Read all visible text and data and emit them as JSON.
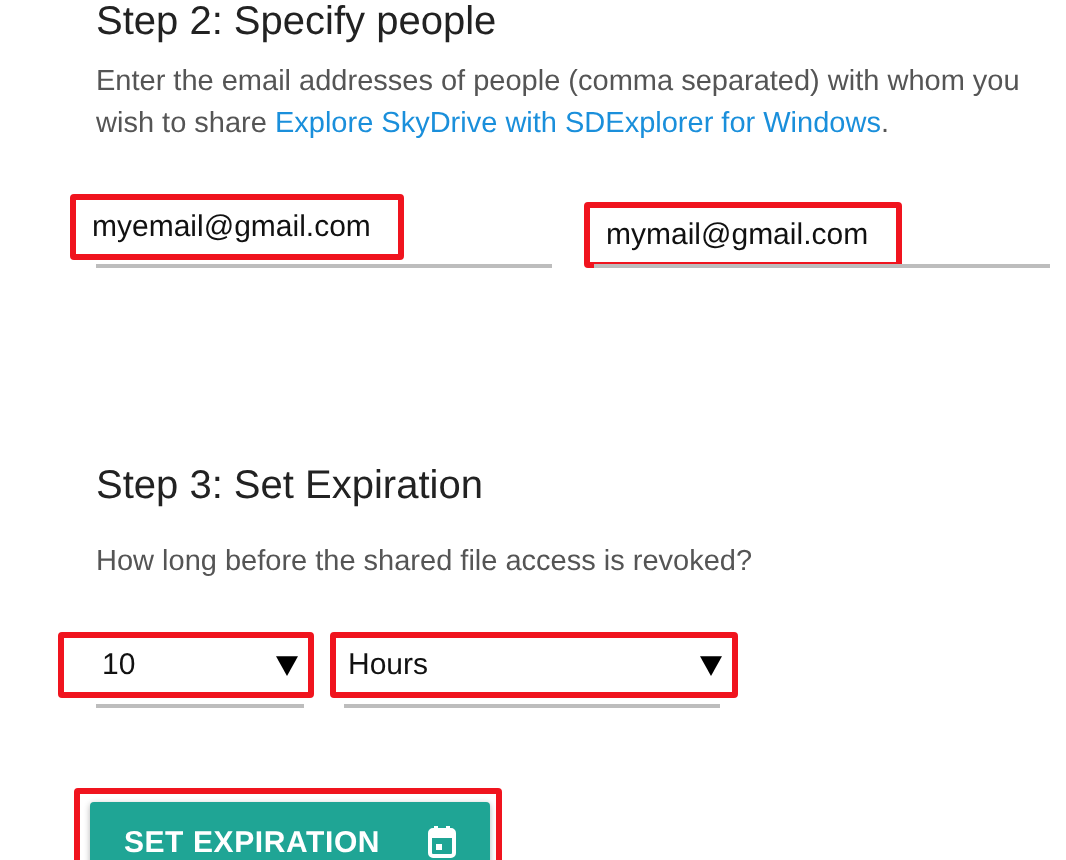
{
  "step2": {
    "heading": "Step 2: Specify people",
    "description_text": "Enter the email addresses of people (comma separated) with whom you wish to share ",
    "link": "Explore SkyDrive with SDExplorer for Windows",
    "description_end": ".",
    "emails": [
      {
        "value": "myemail@gmail.com",
        "highlighted": true
      },
      {
        "value": "mymail@gmail.com",
        "highlighted": true
      }
    ]
  },
  "step3": {
    "heading": "Step 3: Set Expiration",
    "question": "How long before the shared file access is revoked?",
    "selects": [
      {
        "kind": "amount",
        "value": "10",
        "highlighted": true
      },
      {
        "kind": "unit",
        "value": "Hours",
        "highlighted": true
      }
    ],
    "button": {
      "label": "SET EXPIRATION",
      "highlighted": true
    }
  }
}
